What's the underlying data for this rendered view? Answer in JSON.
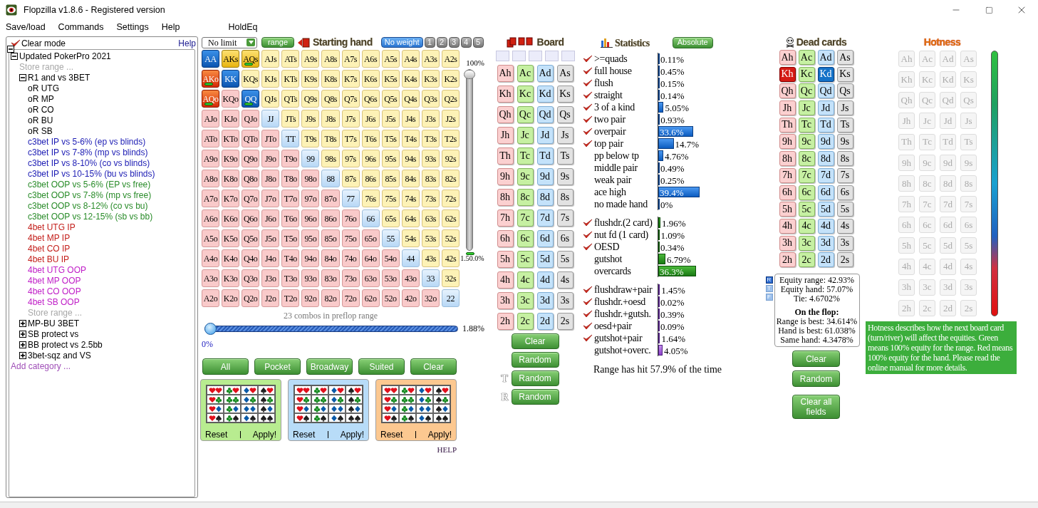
{
  "window": {
    "title": "Flopzilla v1.8.6 - Registered version"
  },
  "menu": [
    "Save/load",
    "Commands",
    "Settings",
    "Help",
    "HoldEq"
  ],
  "tree": {
    "clear_mode": {
      "label": "Clear mode",
      "checked": true
    },
    "help": "Help",
    "items": [
      {
        "label": "Updated PokerPro 2021",
        "kind": "folder",
        "expanded": true,
        "children": [
          {
            "label": "Store range ...",
            "kind": "action"
          },
          {
            "label": "R1 and vs 3BET",
            "kind": "folder",
            "expanded": true,
            "children": [
              {
                "label": "oR UTG",
                "kind": "range",
                "color": "#000000"
              },
              {
                "label": "oR MP",
                "kind": "range",
                "color": "#000000"
              },
              {
                "label": "oR CO",
                "kind": "range",
                "color": "#000000"
              },
              {
                "label": "oR BU",
                "kind": "range",
                "color": "#000000"
              },
              {
                "label": "oR SB",
                "kind": "range",
                "color": "#000000"
              },
              {
                "label": "c3bet IP vs 5-6% (ep vs blinds)",
                "kind": "range",
                "color": "#1c1cb4"
              },
              {
                "label": "c3bet IP vs 7-8% (mp vs blinds)",
                "kind": "range",
                "color": "#1c1cb4"
              },
              {
                "label": "c3bet IP vs 8-10% (co vs blinds)",
                "kind": "range",
                "color": "#1c1cb4"
              },
              {
                "label": "c3bet IP vs 10-15% (bu vs blinds)",
                "kind": "range",
                "color": "#1c1cb4"
              },
              {
                "label": "c3bet OOP vs 5-6% (EP vs free)",
                "kind": "range",
                "color": "#2a8c2a"
              },
              {
                "label": "c3bet OOP vs 7-8% (mp vs free)",
                "kind": "range",
                "color": "#2a8c2a"
              },
              {
                "label": "c3bet OOP vs 8-12% (co vs bu)",
                "kind": "range",
                "color": "#2a8c2a"
              },
              {
                "label": "c3bet OOP vs 12-15% (sb vs bb)",
                "kind": "range",
                "color": "#2a8c2a"
              },
              {
                "label": "4bet UTG IP",
                "kind": "range",
                "color": "#c4201c"
              },
              {
                "label": "4bet MP IP",
                "kind": "range",
                "color": "#c4201c"
              },
              {
                "label": "4bet CO IP",
                "kind": "range",
                "color": "#c4201c"
              },
              {
                "label": "4bet BU IP",
                "kind": "range",
                "color": "#c4201c"
              },
              {
                "label": "4bet UTG OOP",
                "kind": "range",
                "color": "#c020c8"
              },
              {
                "label": "4bet MP OOP",
                "kind": "range",
                "color": "#c020c8"
              },
              {
                "label": "4bet CO OOP",
                "kind": "range",
                "color": "#c020c8"
              },
              {
                "label": "4bet SB OOP",
                "kind": "range",
                "color": "#c020c8"
              },
              {
                "label": "Store range ...",
                "kind": "action"
              }
            ]
          },
          {
            "label": "MP-BU 3BET",
            "kind": "folder",
            "expanded": false
          },
          {
            "label": "SB protect vs",
            "kind": "folder",
            "expanded": false
          },
          {
            "label": "BB protect vs 2.5bb",
            "kind": "folder",
            "expanded": false
          },
          {
            "label": "3bet-sqz and VS",
            "kind": "folder",
            "expanded": false
          }
        ]
      },
      {
        "label": "Add category ...",
        "kind": "add"
      }
    ]
  },
  "range": {
    "game": "No limit",
    "range_button": "range",
    "title": "Starting hand",
    "weights": [
      {
        "label": "No weight",
        "selected": true
      },
      {
        "label": "1",
        "selected": false
      },
      {
        "label": "2",
        "selected": false
      },
      {
        "label": "3",
        "selected": false
      },
      {
        "label": "4",
        "selected": false
      },
      {
        "label": "5",
        "selected": false
      }
    ],
    "rows": [
      {
        "cells": [
          {
            "label": "AA",
            "selected": true,
            "weighted": false
          },
          {
            "label": "AKs",
            "selected": true,
            "weighted": false
          },
          {
            "label": "AQs",
            "selected": true,
            "weighted": true
          },
          {
            "label": "AJs",
            "selected": false,
            "weighted": false
          },
          {
            "label": "ATs",
            "selected": false,
            "weighted": false
          },
          {
            "label": "A9s",
            "selected": false,
            "weighted": false
          },
          {
            "label": "A8s",
            "selected": false,
            "weighted": false
          },
          {
            "label": "A7s",
            "selected": false,
            "weighted": false
          },
          {
            "label": "A6s",
            "selected": false,
            "weighted": false
          },
          {
            "label": "A5s",
            "selected": false,
            "weighted": false
          },
          {
            "label": "A4s",
            "selected": false,
            "weighted": false
          },
          {
            "label": "A3s",
            "selected": false,
            "weighted": false
          },
          {
            "label": "A2s",
            "selected": false,
            "weighted": false
          }
        ]
      },
      {
        "cells": [
          {
            "label": "AKo",
            "selected": true,
            "weighted": true
          },
          {
            "label": "KK",
            "selected": true,
            "weighted": false
          },
          {
            "label": "KQs",
            "selected": false,
            "weighted": false
          },
          {
            "label": "KJs",
            "selected": false,
            "weighted": false
          },
          {
            "label": "KTs",
            "selected": false,
            "weighted": false
          },
          {
            "label": "K9s",
            "selected": false,
            "weighted": false
          },
          {
            "label": "K8s",
            "selected": false,
            "weighted": false
          },
          {
            "label": "K7s",
            "selected": false,
            "weighted": false
          },
          {
            "label": "K6s",
            "selected": false,
            "weighted": false
          },
          {
            "label": "K5s",
            "selected": false,
            "weighted": false
          },
          {
            "label": "K4s",
            "selected": false,
            "weighted": false
          },
          {
            "label": "K3s",
            "selected": false,
            "weighted": false
          },
          {
            "label": "K2s",
            "selected": false,
            "weighted": false
          }
        ]
      },
      {
        "cells": [
          {
            "label": "AQo",
            "selected": true,
            "weighted": true
          },
          {
            "label": "KQo",
            "selected": false,
            "weighted": false
          },
          {
            "label": "QQ",
            "selected": true,
            "weighted": true
          },
          {
            "label": "QJs",
            "selected": false,
            "weighted": false
          },
          {
            "label": "QTs",
            "selected": false,
            "weighted": false
          },
          {
            "label": "Q9s",
            "selected": false,
            "weighted": false
          },
          {
            "label": "Q8s",
            "selected": false,
            "weighted": false
          },
          {
            "label": "Q7s",
            "selected": false,
            "weighted": false
          },
          {
            "label": "Q6s",
            "selected": false,
            "weighted": false
          },
          {
            "label": "Q5s",
            "selected": false,
            "weighted": false
          },
          {
            "label": "Q4s",
            "selected": false,
            "weighted": false
          },
          {
            "label": "Q3s",
            "selected": false,
            "weighted": false
          },
          {
            "label": "Q2s",
            "selected": false,
            "weighted": false
          }
        ]
      },
      {
        "cells": [
          {
            "label": "AJo",
            "selected": false,
            "weighted": false
          },
          {
            "label": "KJo",
            "selected": false,
            "weighted": false
          },
          {
            "label": "QJo",
            "selected": false,
            "weighted": false
          },
          {
            "label": "JJ",
            "selected": false,
            "weighted": false
          },
          {
            "label": "JTs",
            "selected": false,
            "weighted": false
          },
          {
            "label": "J9s",
            "selected": false,
            "weighted": false
          },
          {
            "label": "J8s",
            "selected": false,
            "weighted": false
          },
          {
            "label": "J7s",
            "selected": false,
            "weighted": false
          },
          {
            "label": "J6s",
            "selected": false,
            "weighted": false
          },
          {
            "label": "J5s",
            "selected": false,
            "weighted": false
          },
          {
            "label": "J4s",
            "selected": false,
            "weighted": false
          },
          {
            "label": "J3s",
            "selected": false,
            "weighted": false
          },
          {
            "label": "J2s",
            "selected": false,
            "weighted": false
          }
        ]
      },
      {
        "cells": [
          {
            "label": "ATo",
            "selected": false,
            "weighted": false
          },
          {
            "label": "KTo",
            "selected": false,
            "weighted": false
          },
          {
            "label": "QTo",
            "selected": false,
            "weighted": false
          },
          {
            "label": "JTo",
            "selected": false,
            "weighted": false
          },
          {
            "label": "TT",
            "selected": false,
            "weighted": false
          },
          {
            "label": "T9s",
            "selected": false,
            "weighted": false
          },
          {
            "label": "T8s",
            "selected": false,
            "weighted": false
          },
          {
            "label": "T7s",
            "selected": false,
            "weighted": false
          },
          {
            "label": "T6s",
            "selected": false,
            "weighted": false
          },
          {
            "label": "T5s",
            "selected": false,
            "weighted": false
          },
          {
            "label": "T4s",
            "selected": false,
            "weighted": false
          },
          {
            "label": "T3s",
            "selected": false,
            "weighted": false
          },
          {
            "label": "T2s",
            "selected": false,
            "weighted": false
          }
        ]
      },
      {
        "cells": [
          {
            "label": "A9o",
            "selected": false,
            "weighted": false
          },
          {
            "label": "K9o",
            "selected": false,
            "weighted": false
          },
          {
            "label": "Q9o",
            "selected": false,
            "weighted": false
          },
          {
            "label": "J9o",
            "selected": false,
            "weighted": false
          },
          {
            "label": "T9o",
            "selected": false,
            "weighted": false
          },
          {
            "label": "99",
            "selected": false,
            "weighted": false
          },
          {
            "label": "98s",
            "selected": false,
            "weighted": false
          },
          {
            "label": "97s",
            "selected": false,
            "weighted": false
          },
          {
            "label": "96s",
            "selected": false,
            "weighted": false
          },
          {
            "label": "95s",
            "selected": false,
            "weighted": false
          },
          {
            "label": "94s",
            "selected": false,
            "weighted": false
          },
          {
            "label": "93s",
            "selected": false,
            "weighted": false
          },
          {
            "label": "92s",
            "selected": false,
            "weighted": false
          }
        ]
      },
      {
        "cells": [
          {
            "label": "A8o",
            "selected": false,
            "weighted": false
          },
          {
            "label": "K8o",
            "selected": false,
            "weighted": false
          },
          {
            "label": "Q8o",
            "selected": false,
            "weighted": false
          },
          {
            "label": "J8o",
            "selected": false,
            "weighted": false
          },
          {
            "label": "T8o",
            "selected": false,
            "weighted": false
          },
          {
            "label": "98o",
            "selected": false,
            "weighted": false
          },
          {
            "label": "88",
            "selected": false,
            "weighted": false
          },
          {
            "label": "87s",
            "selected": false,
            "weighted": false
          },
          {
            "label": "86s",
            "selected": false,
            "weighted": false
          },
          {
            "label": "85s",
            "selected": false,
            "weighted": false
          },
          {
            "label": "84s",
            "selected": false,
            "weighted": false
          },
          {
            "label": "83s",
            "selected": false,
            "weighted": false
          },
          {
            "label": "82s",
            "selected": false,
            "weighted": false
          }
        ]
      },
      {
        "cells": [
          {
            "label": "A7o",
            "selected": false,
            "weighted": false
          },
          {
            "label": "K7o",
            "selected": false,
            "weighted": false
          },
          {
            "label": "Q7o",
            "selected": false,
            "weighted": false
          },
          {
            "label": "J7o",
            "selected": false,
            "weighted": false
          },
          {
            "label": "T7o",
            "selected": false,
            "weighted": false
          },
          {
            "label": "97o",
            "selected": false,
            "weighted": false
          },
          {
            "label": "87o",
            "selected": false,
            "weighted": false
          },
          {
            "label": "77",
            "selected": false,
            "weighted": false
          },
          {
            "label": "76s",
            "selected": false,
            "weighted": false
          },
          {
            "label": "75s",
            "selected": false,
            "weighted": false
          },
          {
            "label": "74s",
            "selected": false,
            "weighted": false
          },
          {
            "label": "73s",
            "selected": false,
            "weighted": false
          },
          {
            "label": "72s",
            "selected": false,
            "weighted": false
          }
        ]
      },
      {
        "cells": [
          {
            "label": "A6o",
            "selected": false,
            "weighted": false
          },
          {
            "label": "K6o",
            "selected": false,
            "weighted": false
          },
          {
            "label": "Q6o",
            "selected": false,
            "weighted": false
          },
          {
            "label": "J6o",
            "selected": false,
            "weighted": false
          },
          {
            "label": "T6o",
            "selected": false,
            "weighted": false
          },
          {
            "label": "96o",
            "selected": false,
            "weighted": false
          },
          {
            "label": "86o",
            "selected": false,
            "weighted": false
          },
          {
            "label": "76o",
            "selected": false,
            "weighted": false
          },
          {
            "label": "66",
            "selected": false,
            "weighted": false
          },
          {
            "label": "65s",
            "selected": false,
            "weighted": false
          },
          {
            "label": "64s",
            "selected": false,
            "weighted": false
          },
          {
            "label": "63s",
            "selected": false,
            "weighted": false
          },
          {
            "label": "62s",
            "selected": false,
            "weighted": false
          }
        ]
      },
      {
        "cells": [
          {
            "label": "A5o",
            "selected": false,
            "weighted": false
          },
          {
            "label": "K5o",
            "selected": false,
            "weighted": false
          },
          {
            "label": "Q5o",
            "selected": false,
            "weighted": false
          },
          {
            "label": "J5o",
            "selected": false,
            "weighted": false
          },
          {
            "label": "T5o",
            "selected": false,
            "weighted": false
          },
          {
            "label": "95o",
            "selected": false,
            "weighted": false
          },
          {
            "label": "85o",
            "selected": false,
            "weighted": false
          },
          {
            "label": "75o",
            "selected": false,
            "weighted": false
          },
          {
            "label": "65o",
            "selected": false,
            "weighted": false
          },
          {
            "label": "55",
            "selected": false,
            "weighted": false
          },
          {
            "label": "54s",
            "selected": false,
            "weighted": false
          },
          {
            "label": "53s",
            "selected": false,
            "weighted": false
          },
          {
            "label": "52s",
            "selected": false,
            "weighted": false
          }
        ]
      },
      {
        "cells": [
          {
            "label": "A4o",
            "selected": false,
            "weighted": false
          },
          {
            "label": "K4o",
            "selected": false,
            "weighted": false
          },
          {
            "label": "Q4o",
            "selected": false,
            "weighted": false
          },
          {
            "label": "J4o",
            "selected": false,
            "weighted": false
          },
          {
            "label": "T4o",
            "selected": false,
            "weighted": false
          },
          {
            "label": "94o",
            "selected": false,
            "weighted": false
          },
          {
            "label": "84o",
            "selected": false,
            "weighted": false
          },
          {
            "label": "74o",
            "selected": false,
            "weighted": false
          },
          {
            "label": "64o",
            "selected": false,
            "weighted": false
          },
          {
            "label": "54o",
            "selected": false,
            "weighted": false
          },
          {
            "label": "44",
            "selected": false,
            "weighted": false
          },
          {
            "label": "43s",
            "selected": false,
            "weighted": false
          },
          {
            "label": "42s",
            "selected": false,
            "weighted": false
          }
        ]
      },
      {
        "cells": [
          {
            "label": "A3o",
            "selected": false,
            "weighted": false
          },
          {
            "label": "K3o",
            "selected": false,
            "weighted": false
          },
          {
            "label": "Q3o",
            "selected": false,
            "weighted": false
          },
          {
            "label": "J3o",
            "selected": false,
            "weighted": false
          },
          {
            "label": "T3o",
            "selected": false,
            "weighted": false
          },
          {
            "label": "93o",
            "selected": false,
            "weighted": false
          },
          {
            "label": "83o",
            "selected": false,
            "weighted": false
          },
          {
            "label": "73o",
            "selected": false,
            "weighted": false
          },
          {
            "label": "63o",
            "selected": false,
            "weighted": false
          },
          {
            "label": "53o",
            "selected": false,
            "weighted": false
          },
          {
            "label": "43o",
            "selected": false,
            "weighted": false
          },
          {
            "label": "33",
            "selected": false,
            "weighted": false
          },
          {
            "label": "32s",
            "selected": false,
            "weighted": false
          }
        ]
      },
      {
        "cells": [
          {
            "label": "A2o",
            "selected": false,
            "weighted": false
          },
          {
            "label": "K2o",
            "selected": false,
            "weighted": false
          },
          {
            "label": "Q2o",
            "selected": false,
            "weighted": false
          },
          {
            "label": "J2o",
            "selected": false,
            "weighted": false
          },
          {
            "label": "T2o",
            "selected": false,
            "weighted": false
          },
          {
            "label": "92o",
            "selected": false,
            "weighted": false
          },
          {
            "label": "82o",
            "selected": false,
            "weighted": false
          },
          {
            "label": "72o",
            "selected": false,
            "weighted": false
          },
          {
            "label": "62o",
            "selected": false,
            "weighted": false
          },
          {
            "label": "52o",
            "selected": false,
            "weighted": false
          },
          {
            "label": "42o",
            "selected": false,
            "weighted": false
          },
          {
            "label": "32o",
            "selected": false,
            "weighted": false
          },
          {
            "label": "22",
            "selected": false,
            "weighted": false
          }
        ]
      }
    ],
    "weight_slider": {
      "top_label": "100%",
      "level": 1,
      "bottom_label": "1.",
      "weight_label": "50.0%"
    },
    "combos": "23 combos in preflop range",
    "percent_slider": {
      "level": 0,
      "min_label": "0%",
      "value": "1.88%"
    },
    "filters": [
      "All",
      "Pocket",
      "Broadway",
      "Suited",
      "Clear"
    ],
    "suit_panels": [
      {
        "color": "#b8ec90",
        "reset": "Reset",
        "apply": "Apply!"
      },
      {
        "color": "#b8dcf8",
        "reset": "Reset",
        "apply": "Apply!"
      },
      {
        "color": "#fcc890",
        "reset": "Reset",
        "apply": "Apply!"
      }
    ],
    "help": "HELP"
  },
  "board": {
    "title": "Board",
    "cards": [
      {
        "label": "Ah",
        "selected": false
      },
      {
        "label": "Ac",
        "selected": false
      },
      {
        "label": "Ad",
        "selected": false
      },
      {
        "label": "As",
        "selected": false
      },
      {
        "label": "Kh",
        "selected": false
      },
      {
        "label": "Kc",
        "selected": false
      },
      {
        "label": "Kd",
        "selected": false
      },
      {
        "label": "Ks",
        "selected": false
      },
      {
        "label": "Qh",
        "selected": false
      },
      {
        "label": "Qc",
        "selected": false
      },
      {
        "label": "Qd",
        "selected": false
      },
      {
        "label": "Qs",
        "selected": false
      },
      {
        "label": "Jh",
        "selected": false
      },
      {
        "label": "Jc",
        "selected": false
      },
      {
        "label": "Jd",
        "selected": false
      },
      {
        "label": "Js",
        "selected": false
      },
      {
        "label": "Th",
        "selected": false
      },
      {
        "label": "Tc",
        "selected": false
      },
      {
        "label": "Td",
        "selected": false
      },
      {
        "label": "Ts",
        "selected": false
      },
      {
        "label": "9h",
        "selected": false
      },
      {
        "label": "9c",
        "selected": false
      },
      {
        "label": "9d",
        "selected": false
      },
      {
        "label": "9s",
        "selected": false
      },
      {
        "label": "8h",
        "selected": false
      },
      {
        "label": "8c",
        "selected": false
      },
      {
        "label": "8d",
        "selected": false
      },
      {
        "label": "8s",
        "selected": false
      },
      {
        "label": "7h",
        "selected": false
      },
      {
        "label": "7c",
        "selected": false
      },
      {
        "label": "7d",
        "selected": false
      },
      {
        "label": "7s",
        "selected": false
      },
      {
        "label": "6h",
        "selected": false
      },
      {
        "label": "6c",
        "selected": false
      },
      {
        "label": "6d",
        "selected": false
      },
      {
        "label": "6s",
        "selected": false
      },
      {
        "label": "5h",
        "selected": false
      },
      {
        "label": "5c",
        "selected": false
      },
      {
        "label": "5d",
        "selected": false
      },
      {
        "label": "5s",
        "selected": false
      },
      {
        "label": "4h",
        "selected": false
      },
      {
        "label": "4c",
        "selected": false
      },
      {
        "label": "4d",
        "selected": false
      },
      {
        "label": "4s",
        "selected": false
      },
      {
        "label": "3h",
        "selected": false
      },
      {
        "label": "3c",
        "selected": false
      },
      {
        "label": "3d",
        "selected": false
      },
      {
        "label": "3s",
        "selected": false
      },
      {
        "label": "2h",
        "selected": false
      },
      {
        "label": "2c",
        "selected": false
      },
      {
        "label": "2d",
        "selected": false
      },
      {
        "label": "2s",
        "selected": false
      }
    ],
    "buttons": [
      {
        "label": "Clear"
      },
      {
        "label": "Random"
      },
      {
        "prefix": "T",
        "label": "Random"
      },
      {
        "prefix": "R",
        "label": "Random"
      }
    ]
  },
  "statistics": {
    "title": "Statistics",
    "mode": "Absolute",
    "groups": [
      {
        "kind": "made",
        "rows": [
          {
            "label": ">=quads",
            "checked": true,
            "value": "0.11%",
            "level": 0.0011
          },
          {
            "label": "full house",
            "checked": true,
            "value": "0.45%",
            "level": 0.0045
          },
          {
            "label": "flush",
            "checked": true,
            "value": "0.15%",
            "level": 0.0015
          },
          {
            "label": "straight",
            "checked": true,
            "value": "0.14%",
            "level": 0.0014
          },
          {
            "label": "3 of a kind",
            "checked": true,
            "value": "5.05%",
            "level": 0.0505
          },
          {
            "label": "two pair",
            "checked": true,
            "value": "0.93%",
            "level": 0.0093
          },
          {
            "label": "overpair",
            "checked": true,
            "value": "33.6%",
            "level": 0.336
          },
          {
            "label": "top pair",
            "checked": true,
            "value": "14.7%",
            "level": 0.147
          },
          {
            "label": "pp below tp",
            "checked": false,
            "value": "4.76%",
            "level": 0.0476
          },
          {
            "label": "middle pair",
            "checked": false,
            "value": "0.49%",
            "level": 0.0049
          },
          {
            "label": "weak pair",
            "checked": false,
            "value": "0.25%",
            "level": 0.0025
          },
          {
            "label": "ace high",
            "checked": false,
            "value": "39.4%",
            "level": 0.394
          },
          {
            "label": "no made hand",
            "checked": false,
            "value": "0%",
            "level": 0
          }
        ]
      },
      {
        "kind": "draw",
        "rows": [
          {
            "label": "flushdr.(2 card)",
            "checked": true,
            "value": "1.96%",
            "level": 0.0196
          },
          {
            "label": "nut fd (1 card)",
            "checked": true,
            "value": "1.09%",
            "level": 0.0109
          },
          {
            "label": "OESD",
            "checked": true,
            "value": "0.34%",
            "level": 0.0034
          },
          {
            "label": "gutshot",
            "checked": false,
            "value": "6.79%",
            "level": 0.0679
          },
          {
            "label": "overcards",
            "checked": false,
            "value": "36.3%",
            "level": 0.363
          }
        ]
      },
      {
        "kind": "combo",
        "rows": [
          {
            "label": "flushdraw+pair",
            "checked": true,
            "value": "1.45%",
            "level": 0.0145
          },
          {
            "label": "flushdr.+oesd",
            "checked": true,
            "value": "0.02%",
            "level": 0.0002
          },
          {
            "label": "flushdr.+gutsh.",
            "checked": true,
            "value": "0.39%",
            "level": 0.0039
          },
          {
            "label": "oesd+pair",
            "checked": true,
            "value": "0.09%",
            "level": 0.0009
          },
          {
            "label": "gutshot+pair",
            "checked": true,
            "value": "1.64%",
            "level": 0.0164
          },
          {
            "label": "gutshot+overc.",
            "checked": false,
            "value": "4.05%",
            "level": 0.0405
          }
        ]
      }
    ],
    "summary": "Range has hit 57.9% of the time"
  },
  "dead_cards": {
    "title": "Dead cards",
    "cards": [
      {
        "label": "Ah",
        "selected": false
      },
      {
        "label": "Ac",
        "selected": false
      },
      {
        "label": "Ad",
        "selected": false
      },
      {
        "label": "As",
        "selected": false
      },
      {
        "label": "Kh",
        "selected": true
      },
      {
        "label": "Kc",
        "selected": false
      },
      {
        "label": "Kd",
        "selected": true
      },
      {
        "label": "Ks",
        "selected": false
      },
      {
        "label": "Qh",
        "selected": false
      },
      {
        "label": "Qc",
        "selected": false
      },
      {
        "label": "Qd",
        "selected": false
      },
      {
        "label": "Qs",
        "selected": false
      },
      {
        "label": "Jh",
        "selected": false
      },
      {
        "label": "Jc",
        "selected": false
      },
      {
        "label": "Jd",
        "selected": false
      },
      {
        "label": "Js",
        "selected": false
      },
      {
        "label": "Th",
        "selected": false
      },
      {
        "label": "Tc",
        "selected": false
      },
      {
        "label": "Td",
        "selected": false
      },
      {
        "label": "Ts",
        "selected": false
      },
      {
        "label": "9h",
        "selected": false
      },
      {
        "label": "9c",
        "selected": false
      },
      {
        "label": "9d",
        "selected": false
      },
      {
        "label": "9s",
        "selected": false
      },
      {
        "label": "8h",
        "selected": false
      },
      {
        "label": "8c",
        "selected": false
      },
      {
        "label": "8d",
        "selected": false
      },
      {
        "label": "8s",
        "selected": false
      },
      {
        "label": "7h",
        "selected": false
      },
      {
        "label": "7c",
        "selected": false
      },
      {
        "label": "7d",
        "selected": false
      },
      {
        "label": "7s",
        "selected": false
      },
      {
        "label": "6h",
        "selected": false
      },
      {
        "label": "6c",
        "selected": false
      },
      {
        "label": "6d",
        "selected": false
      },
      {
        "label": "6s",
        "selected": false
      },
      {
        "label": "5h",
        "selected": false
      },
      {
        "label": "5c",
        "selected": false
      },
      {
        "label": "5d",
        "selected": false
      },
      {
        "label": "5s",
        "selected": false
      },
      {
        "label": "4h",
        "selected": false
      },
      {
        "label": "4c",
        "selected": false
      },
      {
        "label": "4d",
        "selected": false
      },
      {
        "label": "4s",
        "selected": false
      },
      {
        "label": "3h",
        "selected": false
      },
      {
        "label": "3c",
        "selected": false
      },
      {
        "label": "3d",
        "selected": false
      },
      {
        "label": "3s",
        "selected": false
      },
      {
        "label": "2h",
        "selected": false
      },
      {
        "label": "2c",
        "selected": false
      },
      {
        "label": "2d",
        "selected": false
      },
      {
        "label": "2s",
        "selected": false
      }
    ],
    "streets": [
      {
        "label": "R",
        "selected": true
      },
      {
        "label": "T",
        "selected": false
      },
      {
        "label": "F",
        "selected": false
      }
    ],
    "equity": [
      "Equity range: 42.93%",
      "Equity hand: 57.07%",
      "Tie: 4.6702%"
    ],
    "flop_title": "On the flop:",
    "flop": [
      "Range is best: 34.614%",
      "Hand is best: 61.038%",
      "Same hand: 4.3478%"
    ],
    "buttons": [
      "Clear",
      "Random",
      "Clear all fields"
    ]
  },
  "hotness": {
    "title": "Hotness",
    "cards": [
      "Ah",
      "Ac",
      "Ad",
      "As",
      "Kh",
      "Kc",
      "Kd",
      "Ks",
      "Qh",
      "Qc",
      "Qd",
      "Qs",
      "Jh",
      "Jc",
      "Jd",
      "Js",
      "Th",
      "Tc",
      "Td",
      "Ts",
      "9h",
      "9c",
      "9d",
      "9s",
      "8h",
      "8c",
      "8d",
      "8s",
      "7h",
      "7c",
      "7d",
      "7s",
      "6h",
      "6c",
      "6d",
      "6s",
      "5h",
      "5c",
      "5d",
      "5s",
      "4h",
      "4c",
      "4d",
      "4s",
      "3h",
      "3c",
      "3d",
      "3s",
      "2h",
      "2c",
      "2d",
      "2s"
    ],
    "note": "Hotness describes how the next board card (turn/river) will affect the equities. Green means 100% equity for the range. Red means 100% equity for the hand. Please read the online manual for more details."
  }
}
